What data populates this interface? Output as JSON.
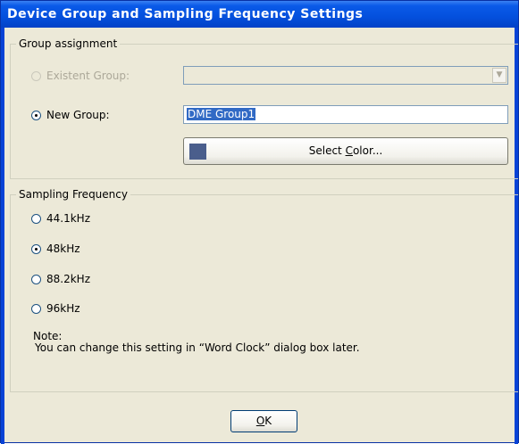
{
  "window": {
    "title": "Device Group and Sampling Frequency Settings"
  },
  "group_assignment": {
    "label": "Group assignment",
    "existent_group": {
      "label": "Existent Group:",
      "selected": false,
      "enabled": false,
      "value": ""
    },
    "new_group": {
      "label": "New Group:",
      "selected": true,
      "value": "DME Group1"
    },
    "select_color_button": {
      "label_pre": "Select ",
      "label_accel": "C",
      "label_post": "olor...",
      "swatch_color": "#4a5e8c"
    }
  },
  "sampling_frequency": {
    "label": "Sampling Frequency",
    "options": [
      {
        "label": "44.1kHz",
        "selected": false
      },
      {
        "label": "48kHz",
        "selected": true
      },
      {
        "label": "88.2kHz",
        "selected": false
      },
      {
        "label": "96kHz",
        "selected": false
      }
    ],
    "note_title": "Note:",
    "note_text": "You can change this setting in “Word Clock” dialog box later."
  },
  "ok_button": {
    "label_accel": "O",
    "label_post": "K"
  },
  "colors": {
    "title_bar": "#0450dd",
    "dialog_bg": "#ece9d8",
    "selection": "#316ac5"
  }
}
